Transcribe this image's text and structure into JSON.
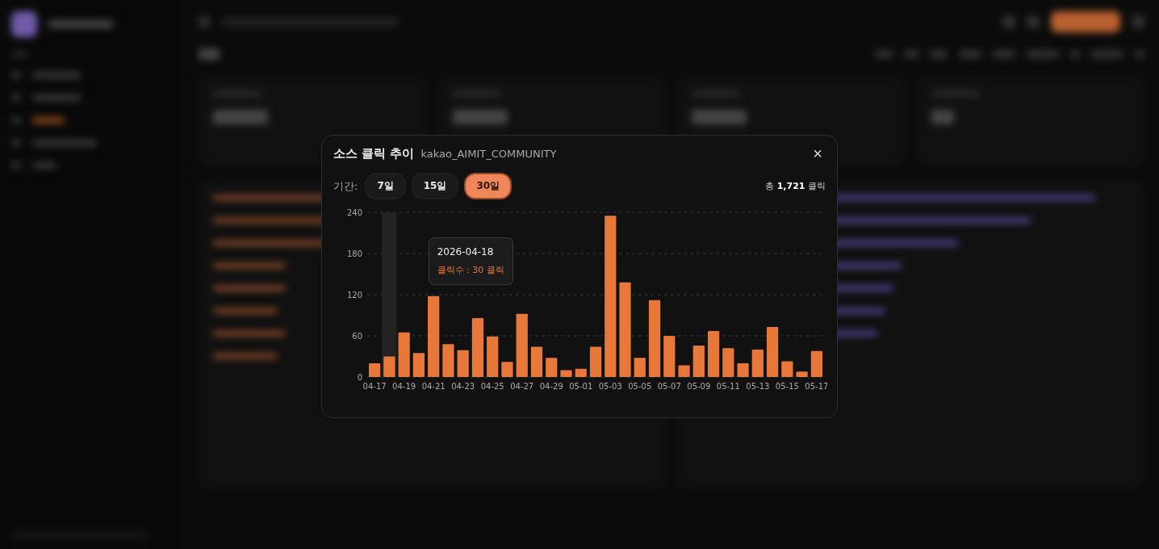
{
  "modal": {
    "title": "소스 클릭 추이",
    "subtitle": "kakao_AIMIT_COMMUNITY",
    "close": "×",
    "period_label": "기간:",
    "periods": [
      {
        "label": "7일",
        "selected": false
      },
      {
        "label": "15일",
        "selected": false
      },
      {
        "label": "30일",
        "selected": true
      }
    ],
    "total_prefix": "총",
    "total_value": "1,721",
    "total_suffix": "클릭",
    "tooltip": {
      "date": "2026-04-18",
      "text": "클릭수 : 30 클릭"
    },
    "chart_data": {
      "type": "bar",
      "grid": true,
      "categories": [
        "04-17",
        null,
        "04-19",
        null,
        "04-21",
        null,
        "04-23",
        null,
        "04-25",
        null,
        "04-27",
        null,
        "04-29",
        null,
        "05-01",
        null,
        "05-03",
        null,
        "05-05",
        null,
        "05-07",
        null,
        "05-09",
        null,
        "05-11",
        null,
        "05-13",
        null,
        "05-15",
        null,
        "05-17"
      ],
      "series": [
        {
          "color": "#e8773a",
          "values": [
            20,
            30,
            65,
            35,
            118,
            48,
            39,
            86,
            59,
            22,
            92,
            44,
            28,
            10,
            12,
            44,
            235,
            138,
            28,
            112,
            60,
            17,
            46,
            67,
            42,
            20,
            40,
            73,
            23,
            8,
            38
          ]
        }
      ],
      "ylim": [
        0,
        240
      ],
      "yticks": [
        0,
        60,
        120,
        180,
        240
      ]
    }
  }
}
